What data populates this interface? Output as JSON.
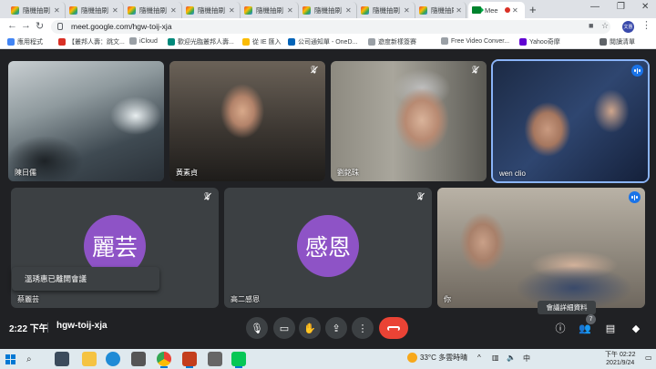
{
  "browser": {
    "tabs": [
      {
        "title": "隨機抽刷",
        "active": false
      },
      {
        "title": "隨機抽刷",
        "active": false
      },
      {
        "title": "隨機抽刷",
        "active": false
      },
      {
        "title": "隨機抽刷",
        "active": false
      },
      {
        "title": "隨機抽刷",
        "active": false
      },
      {
        "title": "隨機抽刷",
        "active": false
      },
      {
        "title": "隨機抽刷",
        "active": false
      },
      {
        "title": "隨機抽刷",
        "active": false
      },
      {
        "title": "Mee",
        "active": true
      }
    ],
    "url": "meet.google.com/hgw-toij-xja",
    "profile_initials": "文惠"
  },
  "bookmarks": [
    {
      "label": "應用程式",
      "color": "#4285f4"
    },
    {
      "label": "【叢邦人壽：跳文...",
      "color": "#d93025"
    },
    {
      "label": "iCloud",
      "color": "#9aa0a6"
    },
    {
      "label": "歡迎光臨叢邦人壽...",
      "color": "#00897b"
    },
    {
      "label": "從 IE 匯入",
      "color": "#fbbc04"
    },
    {
      "label": "公司通知單 - OneD...",
      "color": "#0364b8"
    },
    {
      "label": "遊度新樣簽賽",
      "color": "#9aa0a6"
    },
    {
      "label": "Free Video Conver...",
      "color": "#9aa0a6"
    },
    {
      "label": "Yahoo奇摩",
      "color": "#6001d2"
    },
    {
      "label": "閱讀清單",
      "color": "#5f6368"
    }
  ],
  "participants": [
    {
      "name": "陳日儒",
      "muted": false,
      "speaking": false
    },
    {
      "name": "黃素貞",
      "muted": true,
      "speaking": false
    },
    {
      "name": "劉銘珠",
      "muted": true,
      "speaking": false
    },
    {
      "name": "wen clio",
      "muted": false,
      "speaking": true
    },
    {
      "name": "蔡麗芸",
      "avatar_text": "麗芸",
      "muted": true,
      "speaking": false
    },
    {
      "name": "高二感恩",
      "avatar_text": "感恩",
      "muted": true,
      "speaking": false
    },
    {
      "name": "你",
      "muted": false,
      "speaking": true
    }
  ],
  "notification": "溫琇惠已離開會議",
  "tooltip": "會議詳細資料",
  "meeting": {
    "time": "2:22 下午",
    "code": "hgw-toij-xja",
    "participant_count": "7"
  },
  "taskbar": {
    "weather": "33°C 多雲時晴",
    "clock_time": "下午 02:22",
    "clock_date": "2021/9/24"
  }
}
